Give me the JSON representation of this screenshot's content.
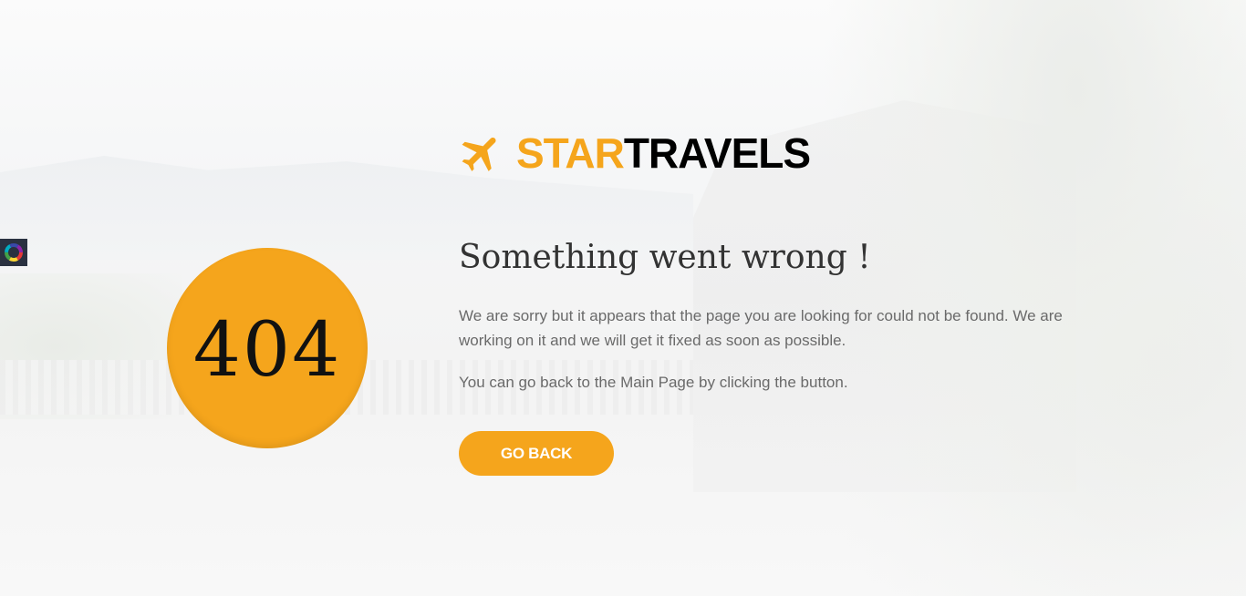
{
  "brand": {
    "name_part1": "STAR",
    "name_part2": "TRAVELS",
    "icon": "airplane-icon",
    "accent_color": "#f5a51c"
  },
  "error": {
    "code": "404",
    "heading": "Something went wrong !",
    "message": "We are sorry but it appears that the page you are looking for could not be found. We are working on it and we will get it fixed as soon as possible.",
    "hint": "You can go back to the Main Page by clicking the button.",
    "button_label": "GO BACK"
  },
  "widget": {
    "icon": "color-wheel-icon"
  }
}
